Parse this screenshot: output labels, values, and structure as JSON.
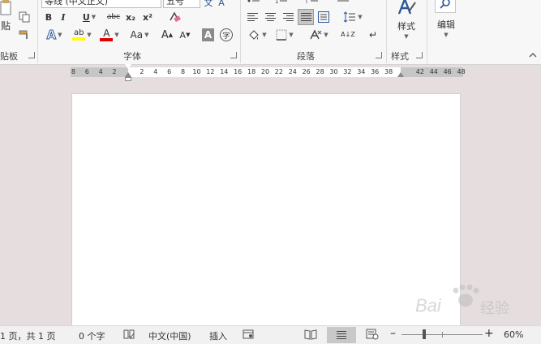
{
  "ribbon": {
    "clipboard": {
      "paste_label": "贴",
      "group_label": "贴板"
    },
    "font": {
      "font_name": "等线 (中文正文)",
      "font_size": "五号",
      "bold": "B",
      "italic": "I",
      "underline": "U",
      "strike": "abc",
      "subscript": "x₂",
      "superscript": "x²",
      "text_effect": "A",
      "highlight": "ab",
      "font_color": "A",
      "change_case": "Aa",
      "grow": "A",
      "shrink": "A",
      "char_shading": "A",
      "enclose": "字",
      "group_label": "字体"
    },
    "paragraph": {
      "group_label": "段落",
      "sort": "A↓Z"
    },
    "styles": {
      "label": "样式",
      "group_label": "样式"
    },
    "editing": {
      "label": "编辑"
    }
  },
  "ruler": {
    "left_ticks": [
      "8",
      "6",
      "4",
      "2"
    ],
    "ticks": [
      "2",
      "4",
      "6",
      "8",
      "10",
      "12",
      "14",
      "16",
      "18",
      "20",
      "22",
      "24",
      "26",
      "28",
      "30",
      "32",
      "34",
      "36",
      "38"
    ],
    "right_ticks": [
      "42",
      "44",
      "46",
      "48"
    ]
  },
  "status": {
    "page": "1 页，共 1 页",
    "words": "0 个字",
    "language": "中文(中国)",
    "mode": "插入",
    "zoom": "60%",
    "zoom_level": 0.6
  },
  "watermark": {
    "text": "Bai",
    "brand": "经验"
  },
  "colors": {
    "highlight": "#ffff00",
    "font_color": "#e00000",
    "accent": "#2b579a"
  }
}
